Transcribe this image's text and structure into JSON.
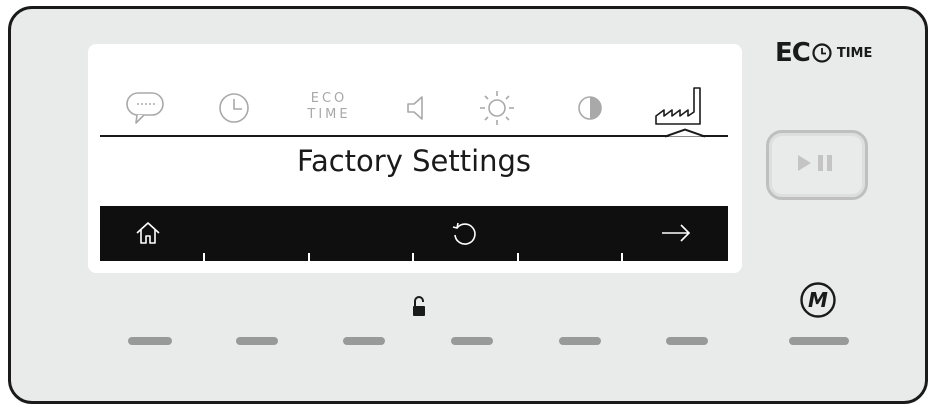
{
  "brand": {
    "eco": "EC",
    "time": "TIME"
  },
  "menu": {
    "items": [
      {
        "icon": "speech-bubble-icon",
        "name": "language"
      },
      {
        "icon": "clock-icon",
        "name": "time"
      },
      {
        "icon": "eco-time-icon",
        "name": "eco-time",
        "line1": "ECO",
        "line2": "TIME"
      },
      {
        "icon": "speaker-icon",
        "name": "sound"
      },
      {
        "icon": "sun-icon",
        "name": "brightness"
      },
      {
        "icon": "contrast-icon",
        "name": "contrast"
      },
      {
        "icon": "factory-icon",
        "name": "factory-settings",
        "selected": true
      }
    ],
    "title": "Factory Settings"
  },
  "nav": {
    "home": "home-icon",
    "reset": "reset-icon",
    "next": "arrow-right-icon"
  },
  "controls": {
    "play_pause": "play-pause-icon",
    "mode": "M",
    "lock": "unlocked-padlock-icon"
  },
  "colors": {
    "panel": "#e8ebea",
    "screen": "#ffffff",
    "inactive_icon": "#a9a9a9",
    "active_icon": "#1a1a1a",
    "nav_bar": "#0f0f0f",
    "key": "#979a99"
  }
}
